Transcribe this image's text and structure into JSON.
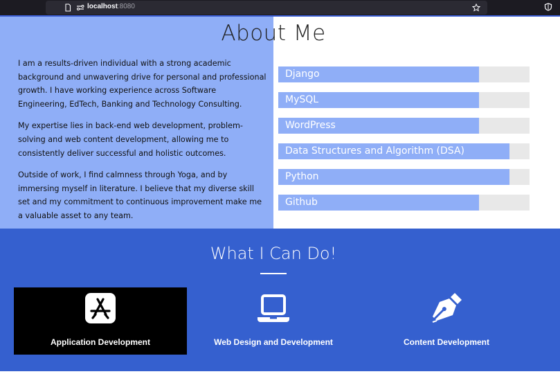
{
  "browser": {
    "url_host": "localhost",
    "url_port": ":8080"
  },
  "about": {
    "title": "About Me",
    "paragraphs": [
      "I am a results-driven individual with a strong academic background and unwavering drive for personal and professional growth. I have working experience across Software Engineering, EdTech, Banking and Technology Consulting.",
      "My expertise lies in back-end web development, problem-solving and web content development, allowing me to consistently deliver successful and holistic outcomes.",
      "Outside of work, I find calmness through Yoga, and by immersing myself in literature. I believe that my diverse skill set and my commitment to continuous improvement make me a valuable asset to any team."
    ],
    "skills": [
      {
        "name": "Django",
        "level": 0.8
      },
      {
        "name": "MySQL",
        "level": 0.8
      },
      {
        "name": "WordPress",
        "level": 0.8
      },
      {
        "name": "Data Structures and Algorithm (DSA)",
        "level": 0.92
      },
      {
        "name": "Python",
        "level": 0.92
      },
      {
        "name": "Github",
        "level": 0.8
      }
    ]
  },
  "services": {
    "title": "What I Can Do!",
    "items": [
      {
        "label": "Application Development",
        "icon": "app-store-icon"
      },
      {
        "label": "Web Design and Development",
        "icon": "laptop-icon"
      },
      {
        "label": "Content Development",
        "icon": "pen-nib-icon"
      }
    ]
  },
  "colors": {
    "accent_light": "#8faef7",
    "accent_dark": "#3560cf",
    "skill_track": "#e8e8e8"
  }
}
